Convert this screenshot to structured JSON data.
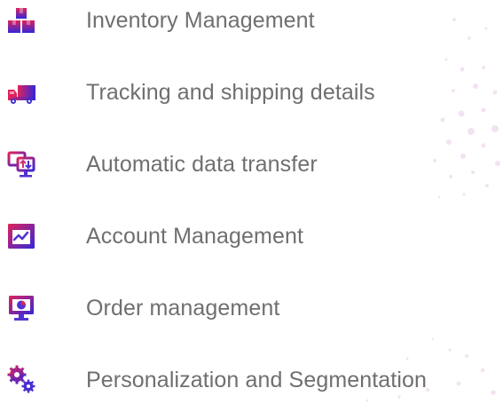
{
  "features": [
    {
      "icon": "boxes-icon",
      "label": "Inventory Management"
    },
    {
      "icon": "truck-icon",
      "label": "Tracking and shipping details"
    },
    {
      "icon": "monitor-transfer-icon",
      "label": "Automatic data transfer"
    },
    {
      "icon": "chart-window-icon",
      "label": "Account Management"
    },
    {
      "icon": "monitor-pie-chart-icon",
      "label": "Order management"
    },
    {
      "icon": "gears-icon",
      "label": "Personalization and Segmentation"
    }
  ],
  "colors": {
    "text": "#6f6f6f",
    "icon_gradient_start": "#e0235a",
    "icon_gradient_end": "#3326d9",
    "dot_color": "#f3e6f4"
  }
}
